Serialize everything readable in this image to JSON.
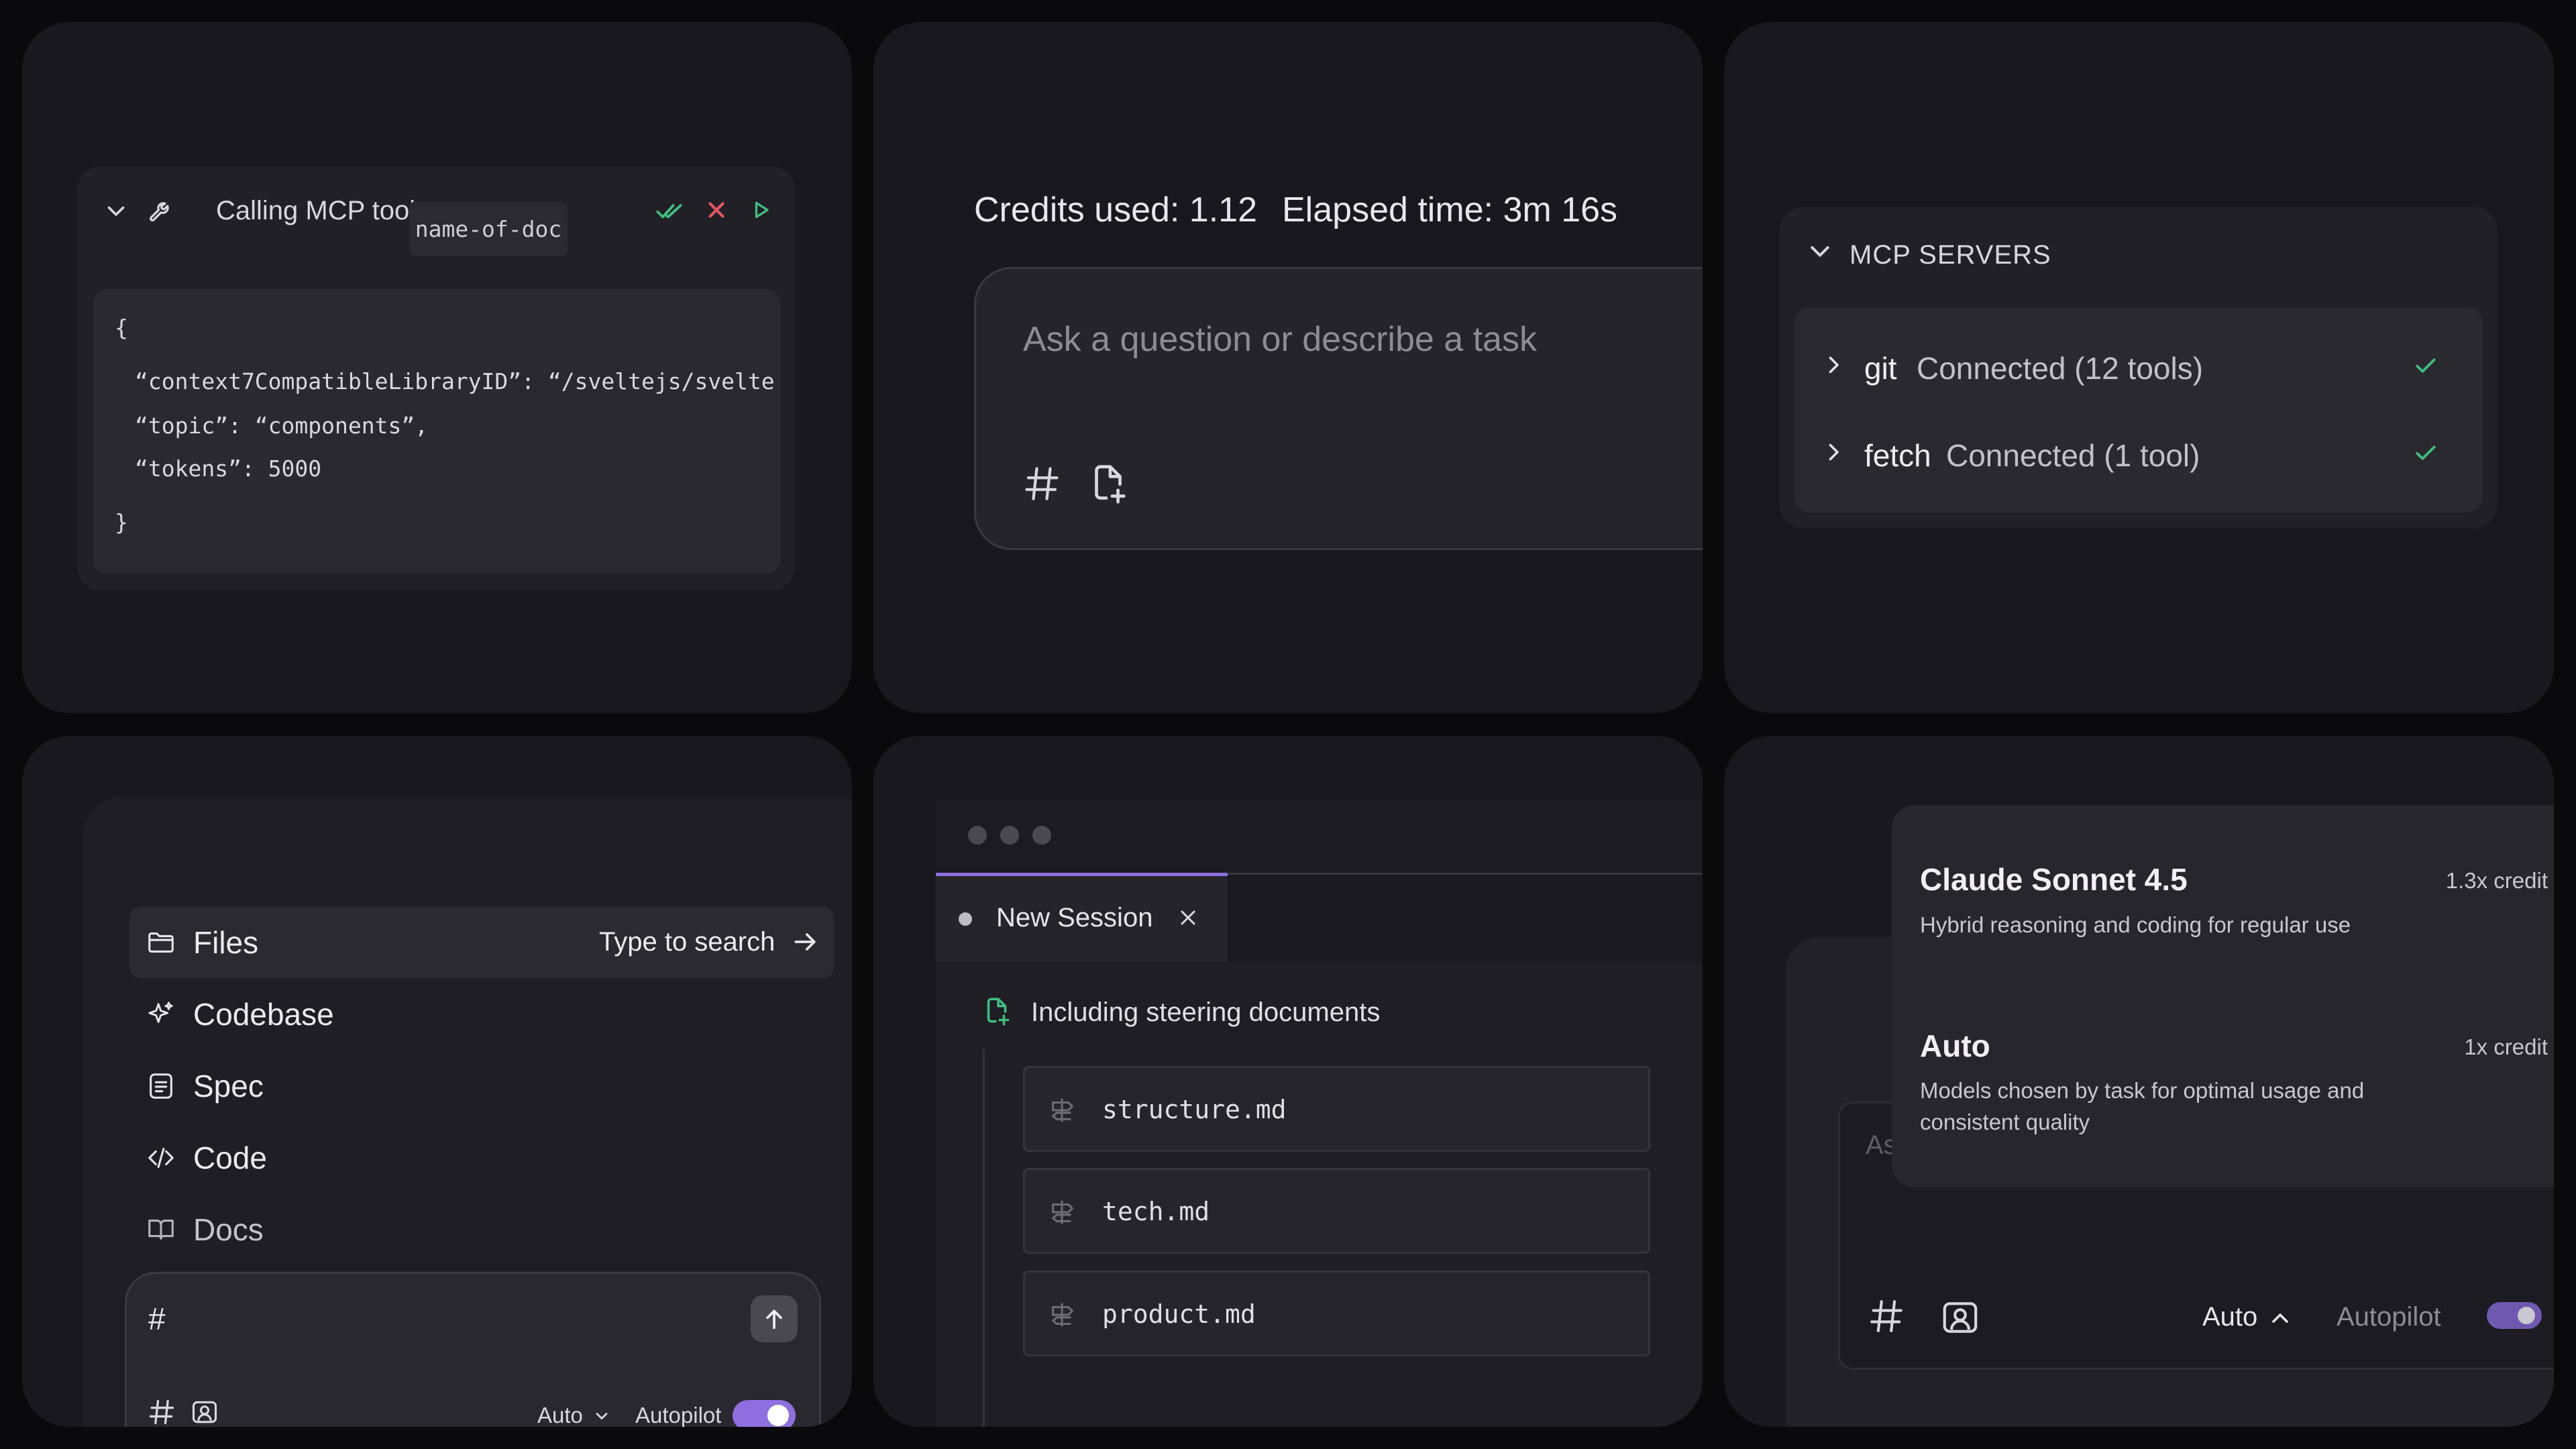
{
  "mcp_tool": {
    "title": "Calling MCP tool",
    "doc_name": "name-of-doc",
    "code_lines": [
      "{",
      "“context7CompatibleLibraryID”: “/sveltejs/svelte",
      "“topic”: “components”,",
      "“tokens”: 5000",
      "}"
    ]
  },
  "session_stats": {
    "credits": "Credits used: 1.12",
    "elapsed": "Elapsed time: 3m 16s",
    "placeholder": "Ask a question or describe a task"
  },
  "mcp_servers": {
    "title": "MCP SERVERS",
    "servers": [
      {
        "name": "git",
        "status": "Connected (12 tools)"
      },
      {
        "name": "fetch",
        "status": "Connected (1 tool)"
      }
    ]
  },
  "context_menu": {
    "items": [
      {
        "label": "Files",
        "hint": "Type to search"
      },
      {
        "label": "Codebase"
      },
      {
        "label": "Spec"
      },
      {
        "label": "Code"
      },
      {
        "label": "Docs"
      }
    ],
    "input_text": "#",
    "model": "Auto",
    "autopilot": "Autopilot"
  },
  "session_window": {
    "tab_label": "New Session",
    "steering_label": "Including steering documents",
    "docs": [
      "structure.md",
      "tech.md",
      "product.md"
    ]
  },
  "model_picker": {
    "models": [
      {
        "name": "Claude Sonnet 4.5",
        "credit": "1.3x credit",
        "desc": "Hybrid reasoning and coding for regular use"
      },
      {
        "name": "Auto",
        "credit": "1x credit",
        "desc": "Models chosen by task for optimal usage and consistent quality"
      }
    ],
    "background_placeholder": "As",
    "selected_model": "Auto",
    "autopilot": "Autopilot"
  },
  "colors": {
    "accent": "#8f6fe0",
    "success": "#3fbf7f",
    "danger": "#e5565f"
  }
}
